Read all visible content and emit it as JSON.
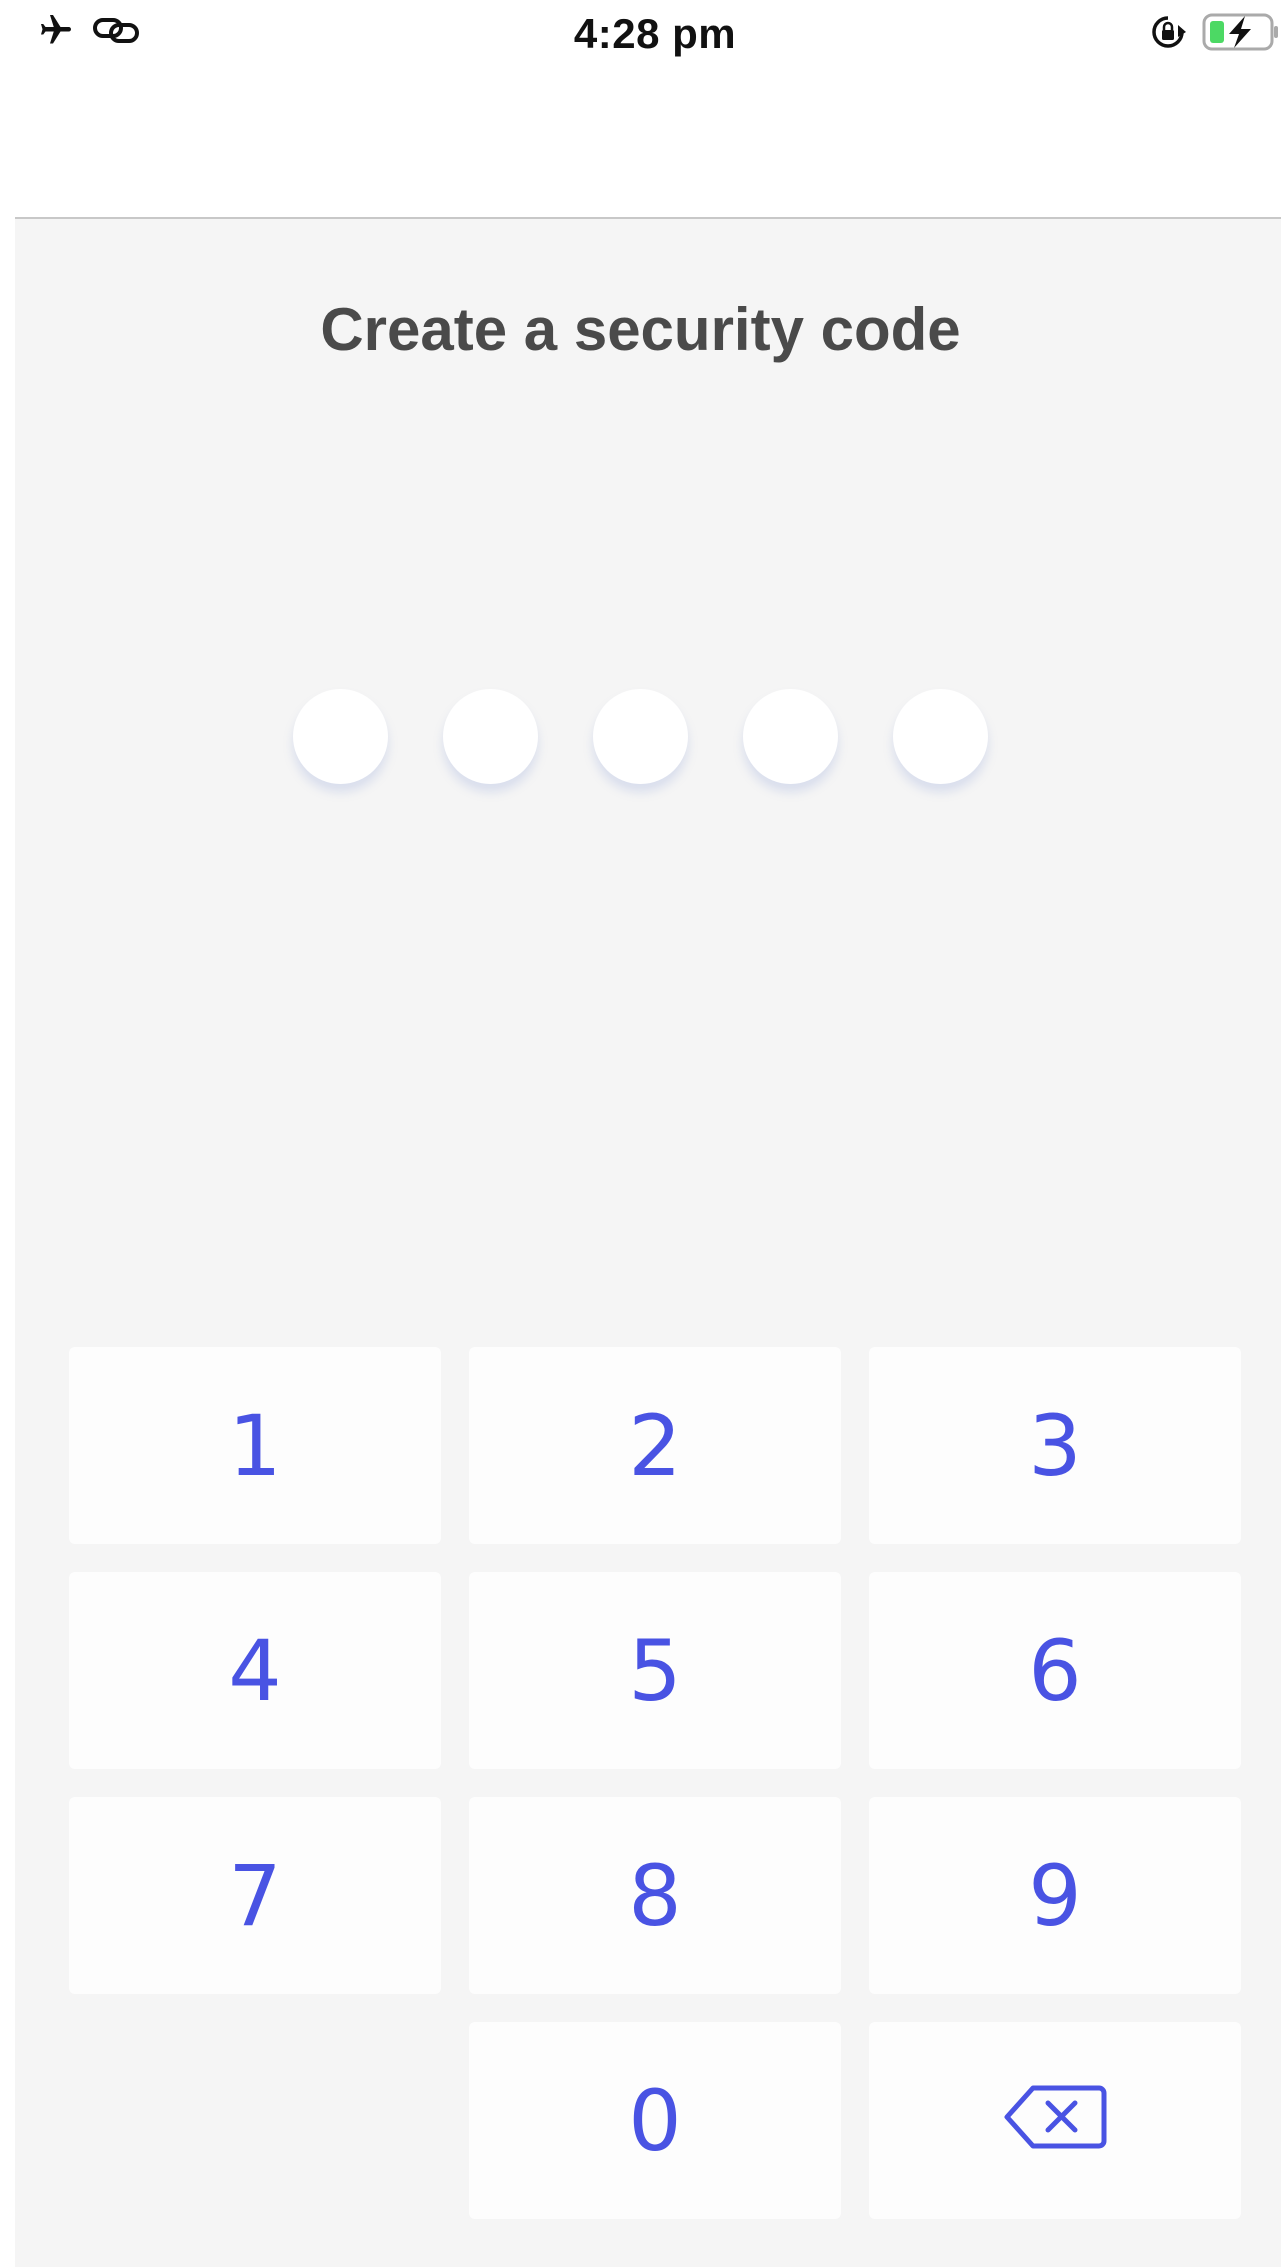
{
  "status_bar": {
    "time": "4:28 pm",
    "icons": [
      "airplane-mode-icon",
      "link-icon",
      "orientation-lock-icon",
      "battery-charging-icon"
    ],
    "battery_color": "#4cd964"
  },
  "screen": {
    "title": "Create a security code",
    "code_length": 5,
    "accent_color": "#4953e3"
  },
  "keypad": {
    "k1": "1",
    "k2": "2",
    "k3": "3",
    "k4": "4",
    "k5": "5",
    "k6": "6",
    "k7": "7",
    "k8": "8",
    "k9": "9",
    "k0": "0",
    "backspace_icon": "backspace-icon"
  }
}
